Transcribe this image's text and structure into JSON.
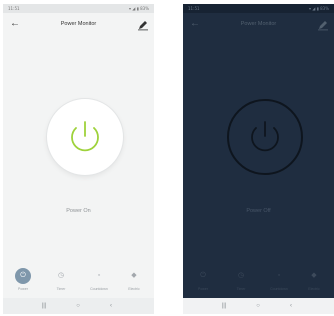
{
  "screens": [
    {
      "status_time": "11:51",
      "status_right": "▾ ◢ ▮ 83%",
      "title": "Power Monitor",
      "state_label": "Power On",
      "tabs": [
        {
          "label": "Power",
          "icon": "power-icon"
        },
        {
          "label": "Timer",
          "icon": "timer-icon"
        },
        {
          "label": "Countdown",
          "icon": "countdown-icon"
        },
        {
          "label": "Electric",
          "icon": "electric-icon"
        }
      ],
      "nav": {
        "recents": "|||",
        "home": "○",
        "back": "‹"
      },
      "colors": {
        "background": "#f3f4f4",
        "power_on": "#9ed23b",
        "active_tab": "#7f97ab"
      }
    },
    {
      "status_time": "11:51",
      "status_right": "▾ ◢ ▮ 83%",
      "title": "Power Monitor",
      "state_label": "Power Off",
      "tabs": [
        {
          "label": "Power",
          "icon": "power-icon"
        },
        {
          "label": "Timer",
          "icon": "timer-icon"
        },
        {
          "label": "Countdown",
          "icon": "countdown-icon"
        },
        {
          "label": "Electric",
          "icon": "electric-icon"
        }
      ],
      "nav": {
        "recents": "|||",
        "home": "○",
        "back": "‹"
      },
      "colors": {
        "background": "#1f2d40",
        "power_off": "#0e151e"
      }
    }
  ]
}
